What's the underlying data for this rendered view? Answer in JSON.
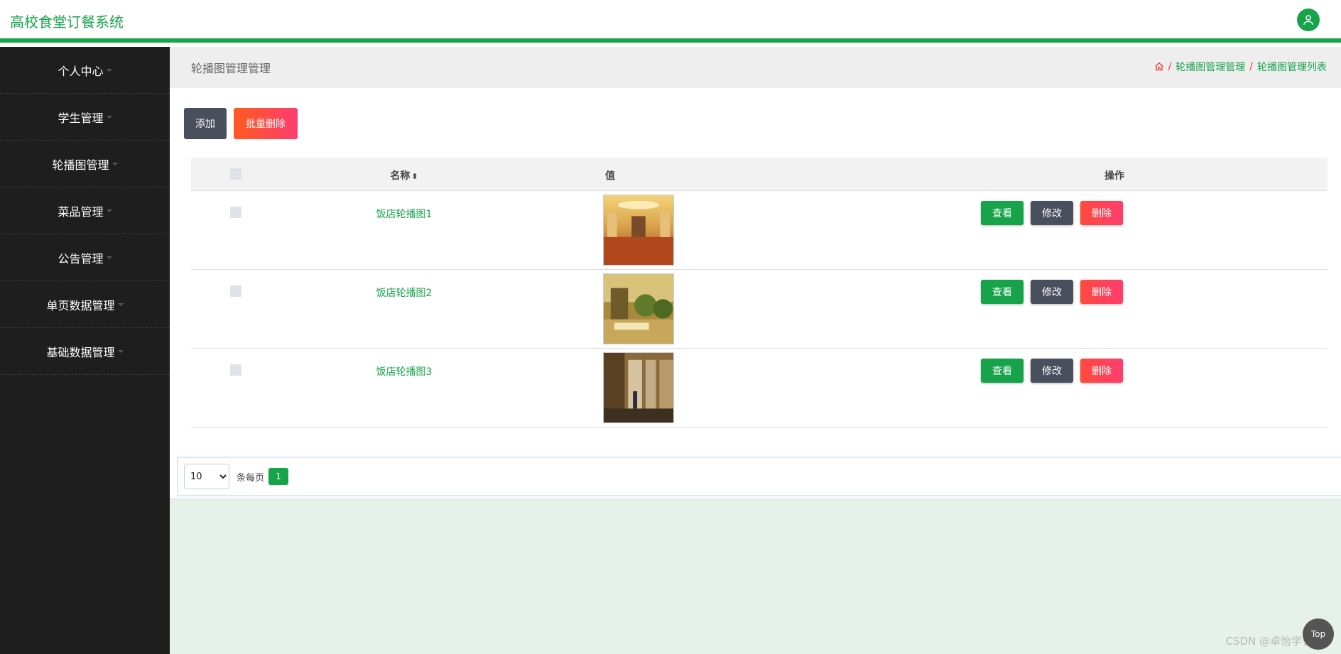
{
  "header": {
    "app_title": "高校食堂订餐系统",
    "avatar_icon": "user-icon"
  },
  "sidebar": {
    "items": [
      {
        "label": "个人中心"
      },
      {
        "label": "学生管理"
      },
      {
        "label": "轮播图管理"
      },
      {
        "label": "菜品管理"
      },
      {
        "label": "公告管理"
      },
      {
        "label": "单页数据管理"
      },
      {
        "label": "基础数据管理"
      }
    ]
  },
  "page": {
    "title": "轮播图管理管理",
    "breadcrumb": [
      "轮播图管理管理",
      "轮播图管理列表"
    ],
    "home_icon": "home-icon"
  },
  "toolbar": {
    "add_label": "添加",
    "batch_delete_label": "批量删除"
  },
  "table": {
    "headers": {
      "name": "名称",
      "value": "值",
      "ops": "操作"
    },
    "rows": [
      {
        "name": "饭店轮播图1",
        "image": "restaurant-hall-photo"
      },
      {
        "name": "饭店轮播图2",
        "image": "restaurant-dining-photo"
      },
      {
        "name": "饭店轮播图3",
        "image": "restaurant-corridor-photo"
      }
    ],
    "ops": {
      "view": "查看",
      "edit": "修改",
      "delete": "删除"
    }
  },
  "pager": {
    "page_size": "10",
    "page_size_options": [
      "10"
    ],
    "per_page_label": "条每页",
    "current_page": "1"
  },
  "footer": {
    "watermark": "CSDN @卓怡学长",
    "top_label": "Top"
  },
  "colors": {
    "accent": "#16a34a",
    "sidebar_bg": "#1e1e1e",
    "danger": "#ff4a3d",
    "dark_button": "#4a4f5e"
  }
}
